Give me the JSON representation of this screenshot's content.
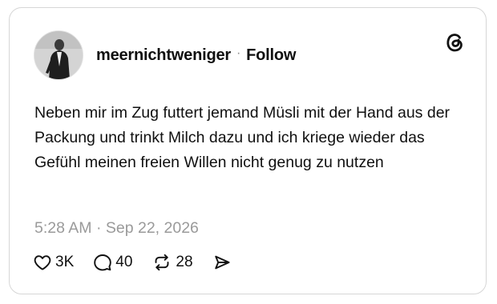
{
  "post": {
    "username": "meernichtweniger",
    "separator": "·",
    "follow_label": "Follow",
    "text": "Neben mir im Zug futtert jemand Müsli mit der Hand aus der Packung und trinkt Milch dazu und ich kriege wieder das Gefühl meinen freien Willen nicht genug zu nutzen",
    "timestamp": "5:28 AM · Sep 22, 2026"
  },
  "actions": {
    "likes": "3K",
    "replies": "40",
    "reposts": "28"
  },
  "icons": {
    "logo": "threads-logo-icon",
    "like": "heart-icon",
    "reply": "speech-bubble-icon",
    "repost": "repost-arrows-icon",
    "share": "send-icon"
  }
}
